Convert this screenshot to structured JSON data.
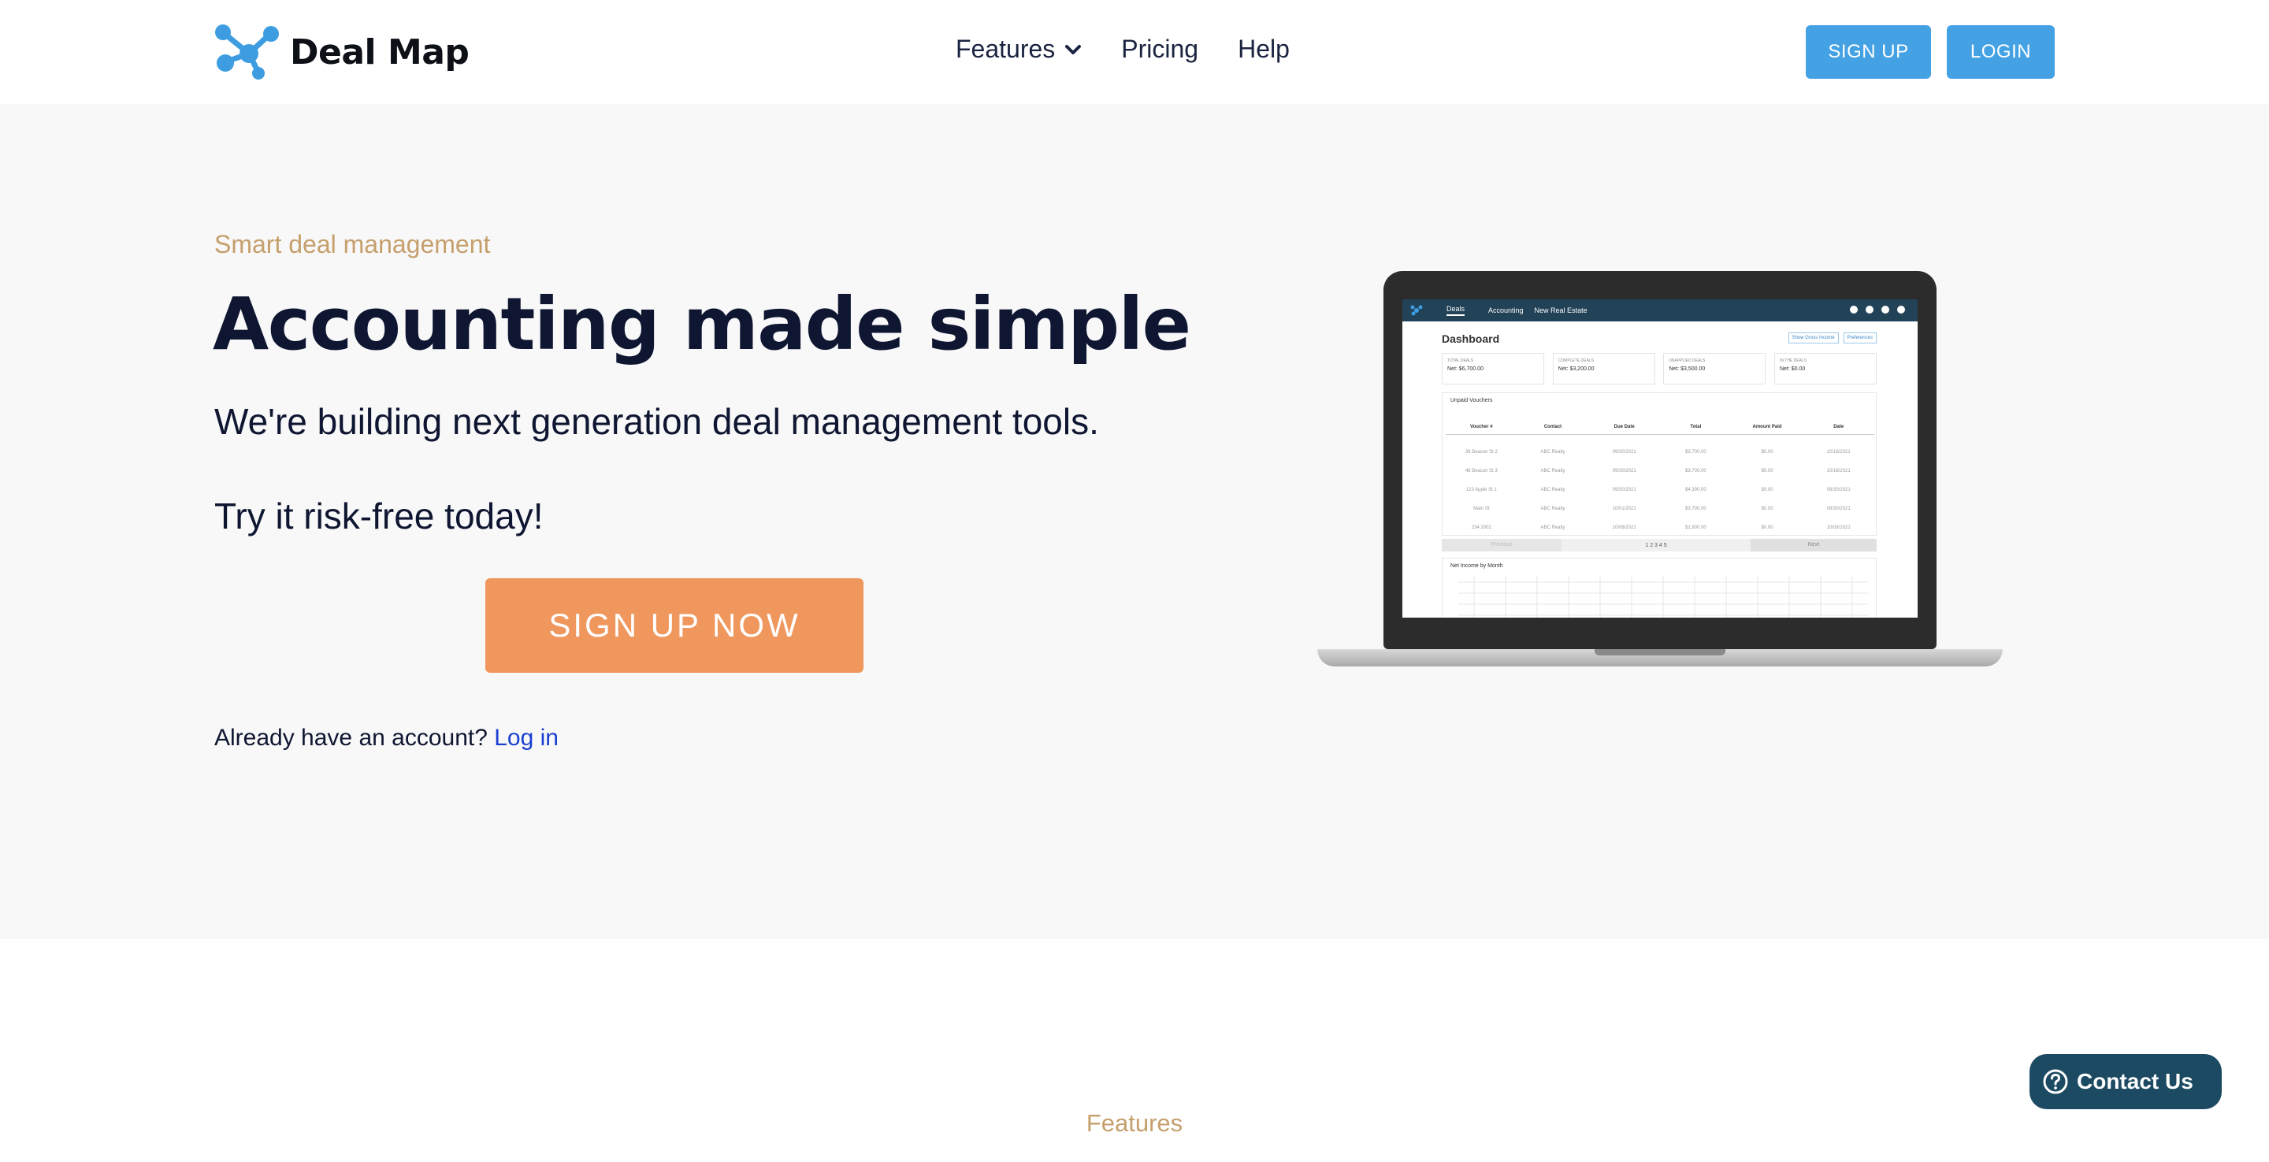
{
  "nav": {
    "brand": "Deal Map",
    "links": [
      {
        "label": "Features",
        "has_dropdown": true
      },
      {
        "label": "Pricing"
      },
      {
        "label": "Help"
      }
    ],
    "signup_label": "SIGN UP",
    "login_label": "LOGIN",
    "accent_color": "#43a1e4"
  },
  "hero": {
    "eyebrow": "Smart deal management",
    "headline": "Accounting made simple",
    "subheadline": "We're building next generation deal management tools.",
    "tagline": "Try it risk-free today!",
    "cta_label": "SIGN UP NOW",
    "cta_color": "#f0975e",
    "account_prompt": "Already have an account?",
    "login_link": "Log in"
  },
  "laptop_app": {
    "tabs": [
      "Deals",
      "Accounting",
      "New Real Estate"
    ],
    "dashboard_title": "Dashboard",
    "header_buttons": [
      "Show Gross Income",
      "Preferences"
    ],
    "kpis": [
      {
        "label": "TOTAL DEALS",
        "value": "Net: $6,700.00"
      },
      {
        "label": "COMPLETE DEALS",
        "value": "Net: $3,200.00"
      },
      {
        "label": "UNAPPLIED DEALS",
        "value": "Net: $3,500.00"
      },
      {
        "label": "IN THE DEALS",
        "value": "Net: $0.00"
      }
    ],
    "vouchers_title": "Unpaid Vouchers",
    "voucher_columns": [
      "Voucher #",
      "Contact",
      "Due Date",
      "Total",
      "Amount Paid",
      "Date"
    ],
    "voucher_rows": [
      [
        "38 Beacon St 2",
        "ABC Realty",
        "09/30/2021",
        "$3,700.00",
        "$0.00",
        "10/16/2021"
      ],
      [
        "48 Beacon St 3",
        "ABC Realty",
        "09/30/2021",
        "$3,700.00",
        "$0.00",
        "10/16/2021"
      ],
      [
        "123 Apple St 1",
        "ABC Realty",
        "09/30/2021",
        "$4,300.00",
        "$0.00",
        "09/30/2021"
      ],
      [
        "Main St",
        "ABC Realty",
        "10/01/2021",
        "$3,700.00",
        "$0.00",
        "09/30/2021"
      ],
      [
        "234 2002",
        "ABC Realty",
        "10/08/2021",
        "$1,800.00",
        "$0.00",
        "10/08/2021"
      ]
    ],
    "pager": {
      "previous": "Previous",
      "pages": "1 2 3 4 5",
      "next": "Next"
    },
    "chart_title": "Net Income by Month"
  },
  "features_label": "Features",
  "contact": {
    "label": "Contact Us",
    "color": "#1c4a62"
  }
}
